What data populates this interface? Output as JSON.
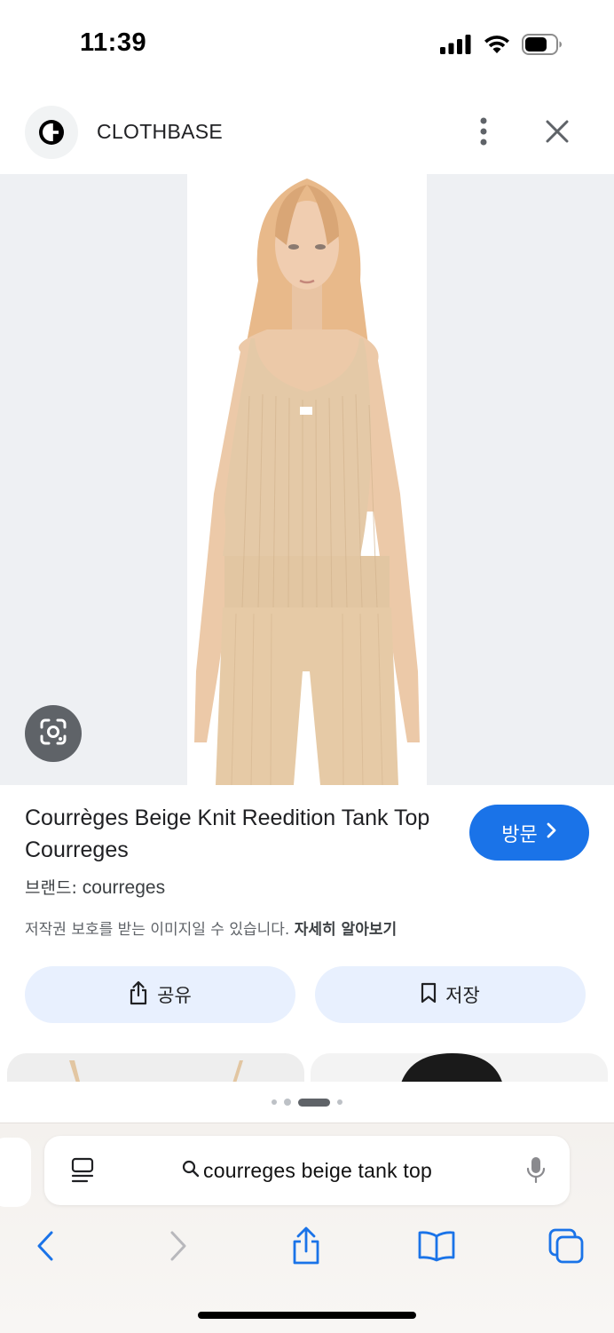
{
  "status_bar": {
    "time": "11:39"
  },
  "site": {
    "name": "CLOTHBASE"
  },
  "product": {
    "title": "Courrèges Beige Knit Reedition Tank Top Courreges",
    "brand_label": "브랜드:",
    "brand_value": "courreges",
    "copyright_notice": "저작권 보호를 받는 이미지일 수 있습니다.",
    "learn_more": "자세히 알아보기",
    "visit_label": "방문"
  },
  "actions": {
    "share_label": "공유",
    "save_label": "저장"
  },
  "carousel": {
    "dot_count": 4,
    "active_index": 2
  },
  "browser": {
    "url_text": "courreges beige tank top"
  },
  "colors": {
    "accent": "#1a73e8",
    "action_bg": "#e8f0fe",
    "image_bg": "#eef0f3",
    "product_beige": "#e2c8a4",
    "ios_blue": "#1a73e8"
  },
  "icons": {
    "status": [
      "signal-icon",
      "wifi-icon",
      "battery-icon"
    ],
    "header": [
      "clothbase-logo-icon",
      "more-vert-icon",
      "close-icon"
    ],
    "toolbar": [
      "back-icon",
      "forward-icon",
      "share-icon",
      "bookmarks-icon",
      "tabs-icon"
    ]
  }
}
